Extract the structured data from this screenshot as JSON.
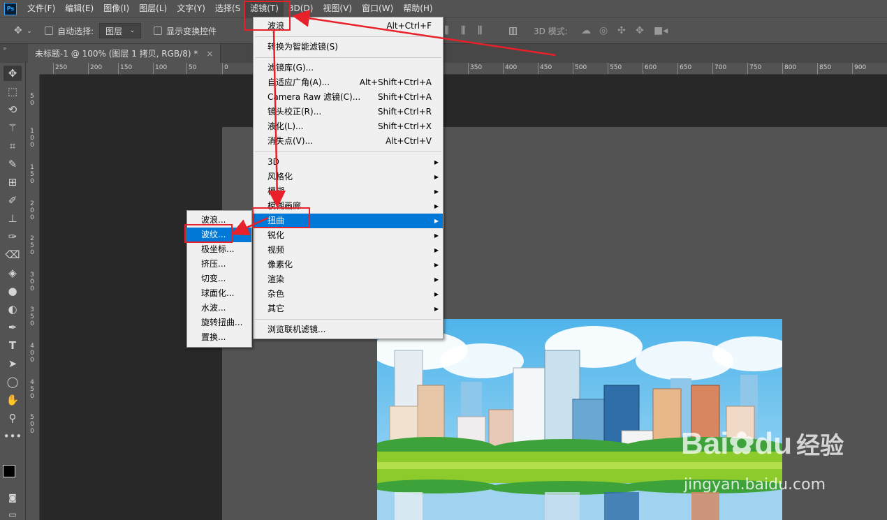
{
  "app": {
    "logo": "Ps",
    "accent": "#31a8ff"
  },
  "menubar": [
    {
      "label": "文件(F)"
    },
    {
      "label": "编辑(E)"
    },
    {
      "label": "图像(I)"
    },
    {
      "label": "图层(L)"
    },
    {
      "label": "文字(Y)"
    },
    {
      "label": "选择(S"
    },
    {
      "label": "滤镜(T)"
    },
    {
      "label": "3D(D)"
    },
    {
      "label": "视图(V)"
    },
    {
      "label": "窗口(W)"
    },
    {
      "label": "帮助(H)"
    }
  ],
  "options_bar": {
    "auto_select_label": "自动选择:",
    "layer_select": "图层",
    "show_transform_label": "显示变换控件",
    "mode_label": "3D 模式:"
  },
  "document_tab": {
    "title": "未标题-1 @ 100% (图层 1 拷贝, RGB/8) *",
    "close": "×"
  },
  "ruler_top": [
    "250",
    "200",
    "150",
    "100",
    "50",
    "0",
    "350",
    "400",
    "450",
    "500",
    "550",
    "600",
    "650",
    "700",
    "750",
    "800",
    "850",
    "900"
  ],
  "ruler_left": [
    "5\n0",
    "1\n0\n0",
    "1\n5\n0",
    "2\n0\n0",
    "2\n5\n0",
    "3\n0\n0",
    "3\n5\n0",
    "4\n0\n0",
    "4\n5\n0",
    "5\n0\n0"
  ],
  "filter_menu": {
    "items": [
      {
        "label": "波浪",
        "shortcut": "Alt+Ctrl+F"
      },
      {
        "label": "转换为智能滤镜(S)",
        "shortcut": ""
      },
      {
        "label": "滤镜库(G)...",
        "shortcut": ""
      },
      {
        "label": "自适应广角(A)...",
        "shortcut": "Alt+Shift+Ctrl+A"
      },
      {
        "label": "Camera Raw 滤镜(C)...",
        "shortcut": "Shift+Ctrl+A"
      },
      {
        "label": "镜头校正(R)...",
        "shortcut": "Shift+Ctrl+R"
      },
      {
        "label": "液化(L)...",
        "shortcut": "Shift+Ctrl+X"
      },
      {
        "label": "消失点(V)...",
        "shortcut": "Alt+Ctrl+V"
      },
      {
        "label": "3D",
        "submenu": true
      },
      {
        "label": "风格化",
        "submenu": true
      },
      {
        "label": "模糊",
        "submenu": true
      },
      {
        "label": "模糊画廊",
        "submenu": true
      },
      {
        "label": "扭曲",
        "submenu": true
      },
      {
        "label": "锐化",
        "submenu": true
      },
      {
        "label": "视频",
        "submenu": true
      },
      {
        "label": "像素化",
        "submenu": true
      },
      {
        "label": "渲染",
        "submenu": true
      },
      {
        "label": "杂色",
        "submenu": true
      },
      {
        "label": "其它",
        "submenu": true
      },
      {
        "label": "浏览联机滤镜..."
      }
    ]
  },
  "distort_submenu": {
    "items": [
      {
        "label": "波浪..."
      },
      {
        "label": "波纹..."
      },
      {
        "label": "极坐标..."
      },
      {
        "label": "挤压..."
      },
      {
        "label": "切变..."
      },
      {
        "label": "球面化..."
      },
      {
        "label": "水波..."
      },
      {
        "label": "旋转扭曲..."
      },
      {
        "label": "置换..."
      }
    ]
  },
  "watermark": {
    "brand": "Bai",
    "brand_tail": "du",
    "suffix": "经验",
    "url": "jingyan.baidu.com"
  },
  "colors": {
    "highlight": "#0078d7",
    "annotation": "#e8202a"
  }
}
